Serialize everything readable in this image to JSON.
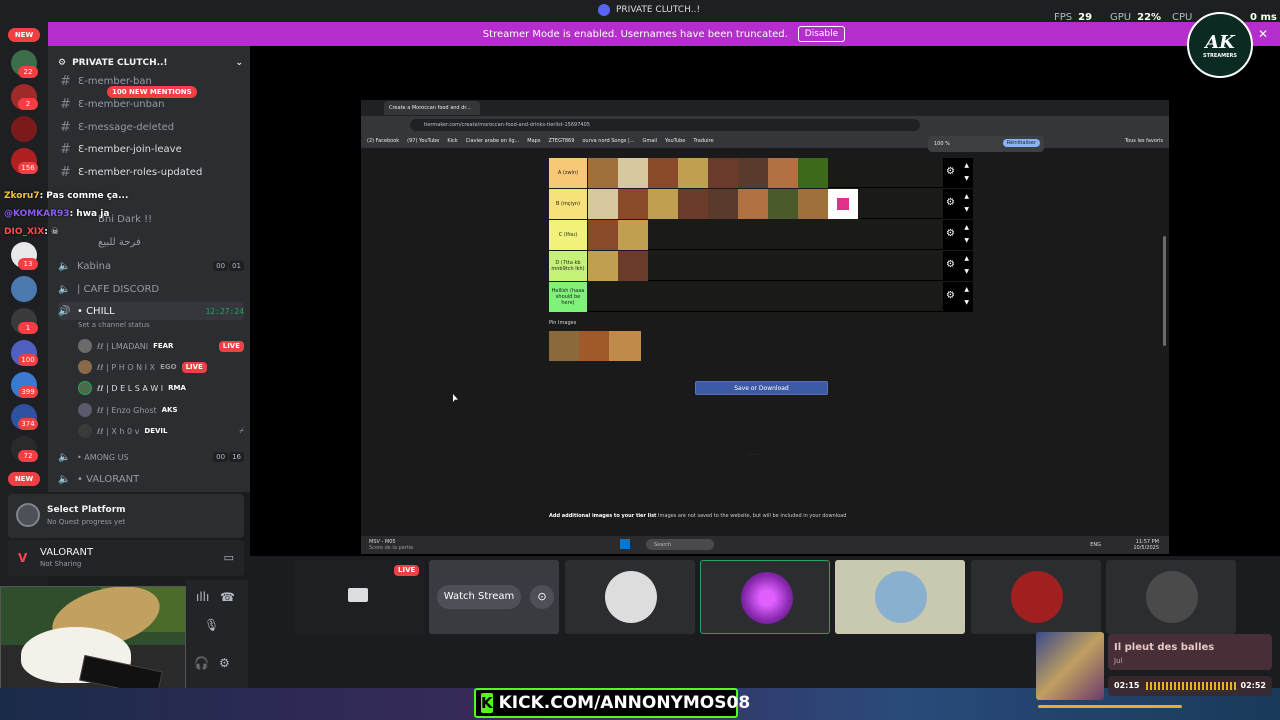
{
  "window": {
    "title": "PRIVATE CLUTCH..!",
    "perf": {
      "fps_label": "FPS",
      "fps": "29",
      "gpu_label": "GPU",
      "gpu": "22%",
      "cpu_label": "CPU",
      "ms": "0 ms"
    }
  },
  "banner": {
    "text": "Streamer Mode is enabled. Usernames have been truncated.",
    "disable_label": "Disable"
  },
  "rail": {
    "new_top": "NEW",
    "new_bottom": "NEW",
    "badges": [
      "22",
      "2",
      "156",
      "13",
      "1",
      "100",
      "399",
      "374",
      "72"
    ]
  },
  "server": {
    "name": "PRIVATE CLUTCH..!",
    "mention_pill": "100 NEW MENTIONS",
    "text_channels": [
      "Ɛ-member-ban",
      "Ɛ-member-unban",
      "Ɛ-message-deleted",
      "Ɛ-member-join-leave",
      "Ɛ-member-roles-updated"
    ],
    "chat_overlay": [
      {
        "user": "Zkoru7",
        "text": ": Pas comme ça..."
      },
      {
        "user": "@KOMKAR93",
        "text": ": hwa ja"
      },
      {
        "user": "DIO_XIX",
        "text": ": ☠"
      }
    ],
    "hidden_channels": [
      "Bni Dark !!",
      "فرحة للبيع"
    ],
    "voice_channels": [
      {
        "name": "Kabina",
        "count_a": "00",
        "count_b": "01"
      },
      {
        "name": "| CAFE DISCORD"
      },
      {
        "name": "• CHILL",
        "time": "12:27:24",
        "status": "Set a channel status"
      },
      {
        "name": "• AMONG US",
        "count_a": "00",
        "count_b": "16"
      },
      {
        "name": "• VALORANT"
      }
    ],
    "voice_users": [
      {
        "name": "ℓℓ | LMADANI",
        "tag": "FEAR",
        "live": "LIVE"
      },
      {
        "name": "ℓℓ | P H O N I X",
        "tag": "EGO",
        "live": "LIVE"
      },
      {
        "name": "ℓℓ | D E L S A W I",
        "tag": "RMA"
      },
      {
        "name": "ℓℓ | Enzo Ghost",
        "tag": "AKS"
      },
      {
        "name": "ℓℓ | X h 0 v",
        "tag": "DEVIL"
      }
    ]
  },
  "quest": {
    "title": "Select Platform",
    "subtitle": "No Quest progress yet"
  },
  "activity": {
    "game": "VALORANT",
    "status": "Not Sharing"
  },
  "browser": {
    "tab_title": "Create a Moroccan food and dr...",
    "url": "tiermaker.com/create/moroccan-food-and-drinks-tierlist-15697405",
    "bookmarks": [
      "(2) Facebook",
      "(97) YouTube",
      "Kick",
      "Clavier arabe en lig...",
      "Maps",
      "ZTEGT869",
      "ourva nord Songs |...",
      "Gmail",
      "YouTube",
      "Traduire"
    ],
    "all_bookmarks": "Tous les favoris",
    "zoom": "100 %",
    "zoom_reset": "Réinitialiser",
    "tiers": [
      {
        "label": "A (zwin)",
        "color": "#f7c977",
        "tiles": 7,
        "extra": "drink"
      },
      {
        "label": "B (mçiyn)",
        "color": "#f7e27a",
        "tiles": 8,
        "extra": "pink"
      },
      {
        "label": "C (lfou)",
        "color": "#f2f27a",
        "tiles": 2
      },
      {
        "label": "D (7tta kb mnb9tch lkh)",
        "color": "#c7f27a",
        "tiles": 2
      },
      {
        "label": "Hellish (haaa should be here)",
        "color": "#7ff27a",
        "tiles": 0
      }
    ],
    "pin_label": "Pin Images",
    "save_label": "Save or Download",
    "add_bold": "Add additional images to your tier list",
    "add_rest": "Images are not saved to the website, but will be included in your download",
    "taskbar": {
      "app": "MSV - M05",
      "app_sub": "Score de la partie",
      "search": "Search",
      "lang": "ENG",
      "time": "11:57 PM",
      "date": "10/5/2025"
    }
  },
  "participants": {
    "live": "LIVE",
    "watch_label": "Watch Stream"
  },
  "kick_text": "KICK.COM/ANNONYMOS08",
  "music": {
    "song": "Il pleut des balles",
    "artist": "Jul",
    "elapsed": "02:15",
    "total": "02:52",
    "progress": 0.78
  },
  "logo": {
    "main": "AK",
    "sub": "STREAMERS"
  }
}
